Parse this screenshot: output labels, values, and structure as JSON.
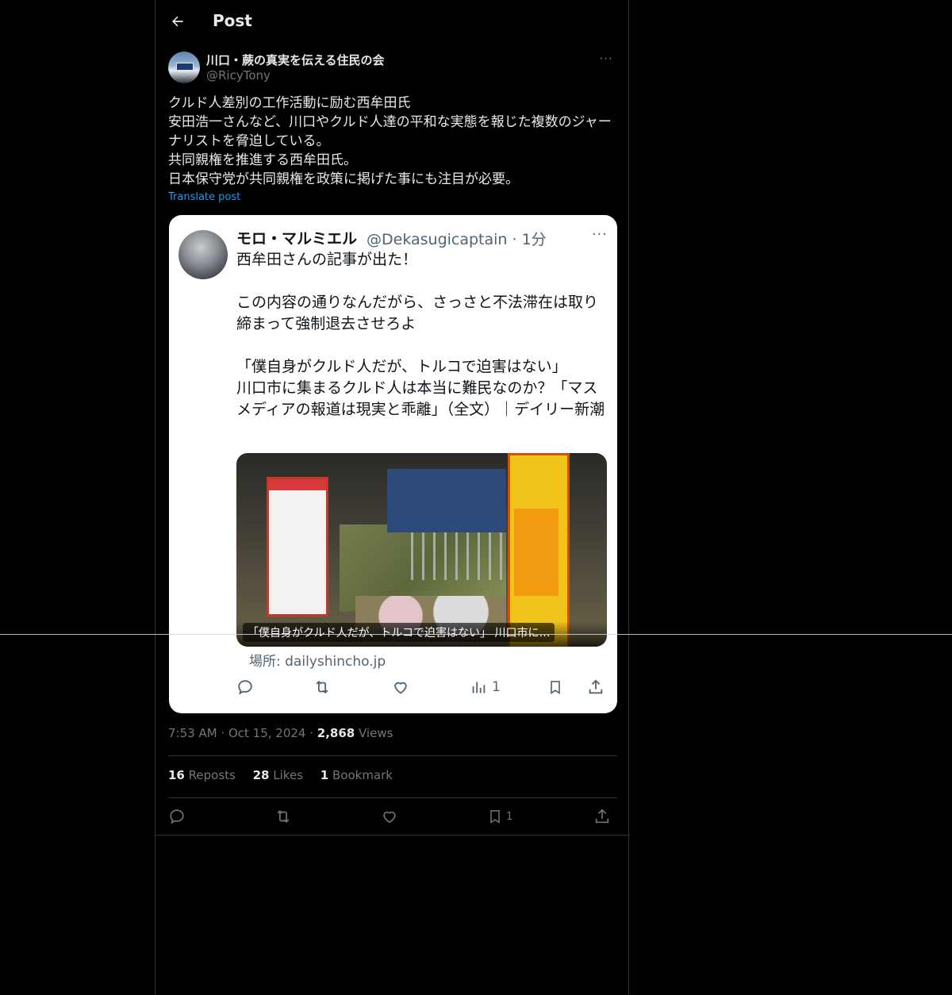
{
  "header": {
    "title": "Post"
  },
  "author": {
    "display_name": "川口・蕨の真実を伝える住民の会",
    "handle": "@RicyTony",
    "more": "···"
  },
  "post": {
    "text": "クルド人差別の工作活動に励む西牟田氏\n安田浩一さんなど、川口やクルド人達の平和な実態を報じた複数のジャーナリストを脅迫している。\n共同親権を推進する西牟田氏。\n日本保守党が共同親権を政策に掲げた事にも注目が必要。",
    "translate_label": "Translate post"
  },
  "embedded_screenshot": {
    "name": "モロ・マルミエル",
    "handle_time": "@Dekasugicaptain · 1分",
    "more": "···",
    "text": "西牟田さんの記事が出た！\n\nこの内容の通りなんだがら、さっさと不法滞在は取り締まって強制退去させろよ\n\n「僕自身がクルド人だが、トルコで迫害はない」\n川口市に集まるクルド人は本当に難民なのか？「マスメディアの報道は現実と乖離」（全文）｜デイリー新潮",
    "card_caption": "「僕自身がクルド人だが、トルコで迫害はない」 川口市に…",
    "source": "場所: dailyshincho.jp",
    "views": "1"
  },
  "meta": {
    "time": "7:53 AM · Oct 15, 2024 · ",
    "views_count": "2,868",
    "views_label": " Views"
  },
  "stats": {
    "reposts_count": "16",
    "reposts_label": " Reposts",
    "likes_count": "28",
    "likes_label": " Likes",
    "bookmarks_count": "1",
    "bookmarks_label": " Bookmark"
  },
  "actions": {
    "bookmark_count": "1"
  },
  "colors": {
    "background": "#000000",
    "text": "#e7e9ea",
    "muted": "#71767b",
    "link": "#1d9bf0",
    "border": "#2f3336"
  }
}
